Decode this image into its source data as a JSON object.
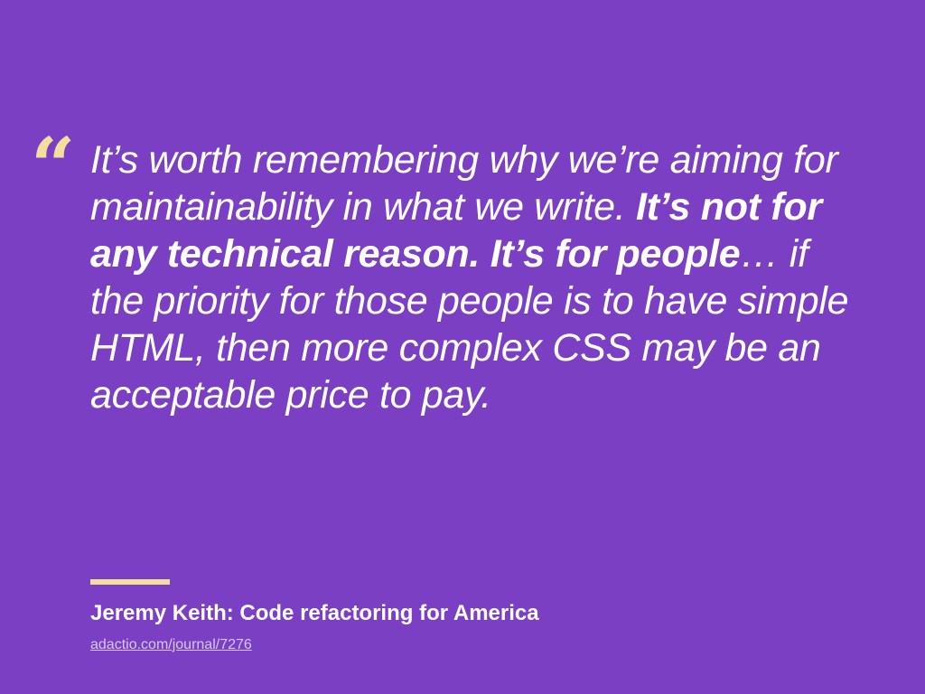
{
  "quote": {
    "mark": "“",
    "segments": [
      {
        "text": "It’s worth remembering why we’re aiming for maintainability in what we write. ",
        "bold": false
      },
      {
        "text": "It’s not for any technical reason. It’s for people",
        "bold": true
      },
      {
        "text": "… if the priority for those people is to have simple HTML, then more complex CSS may be an acceptable price to pay.",
        "bold": false
      }
    ]
  },
  "attribution": {
    "author": "Jeremy Keith: Code refactoring for America",
    "link_text": "adactio.com/journal/7276"
  },
  "colors": {
    "background": "#7b3fc4",
    "accent": "#f3df9c",
    "text": "#ffffff",
    "link": "#d7c8ef"
  }
}
